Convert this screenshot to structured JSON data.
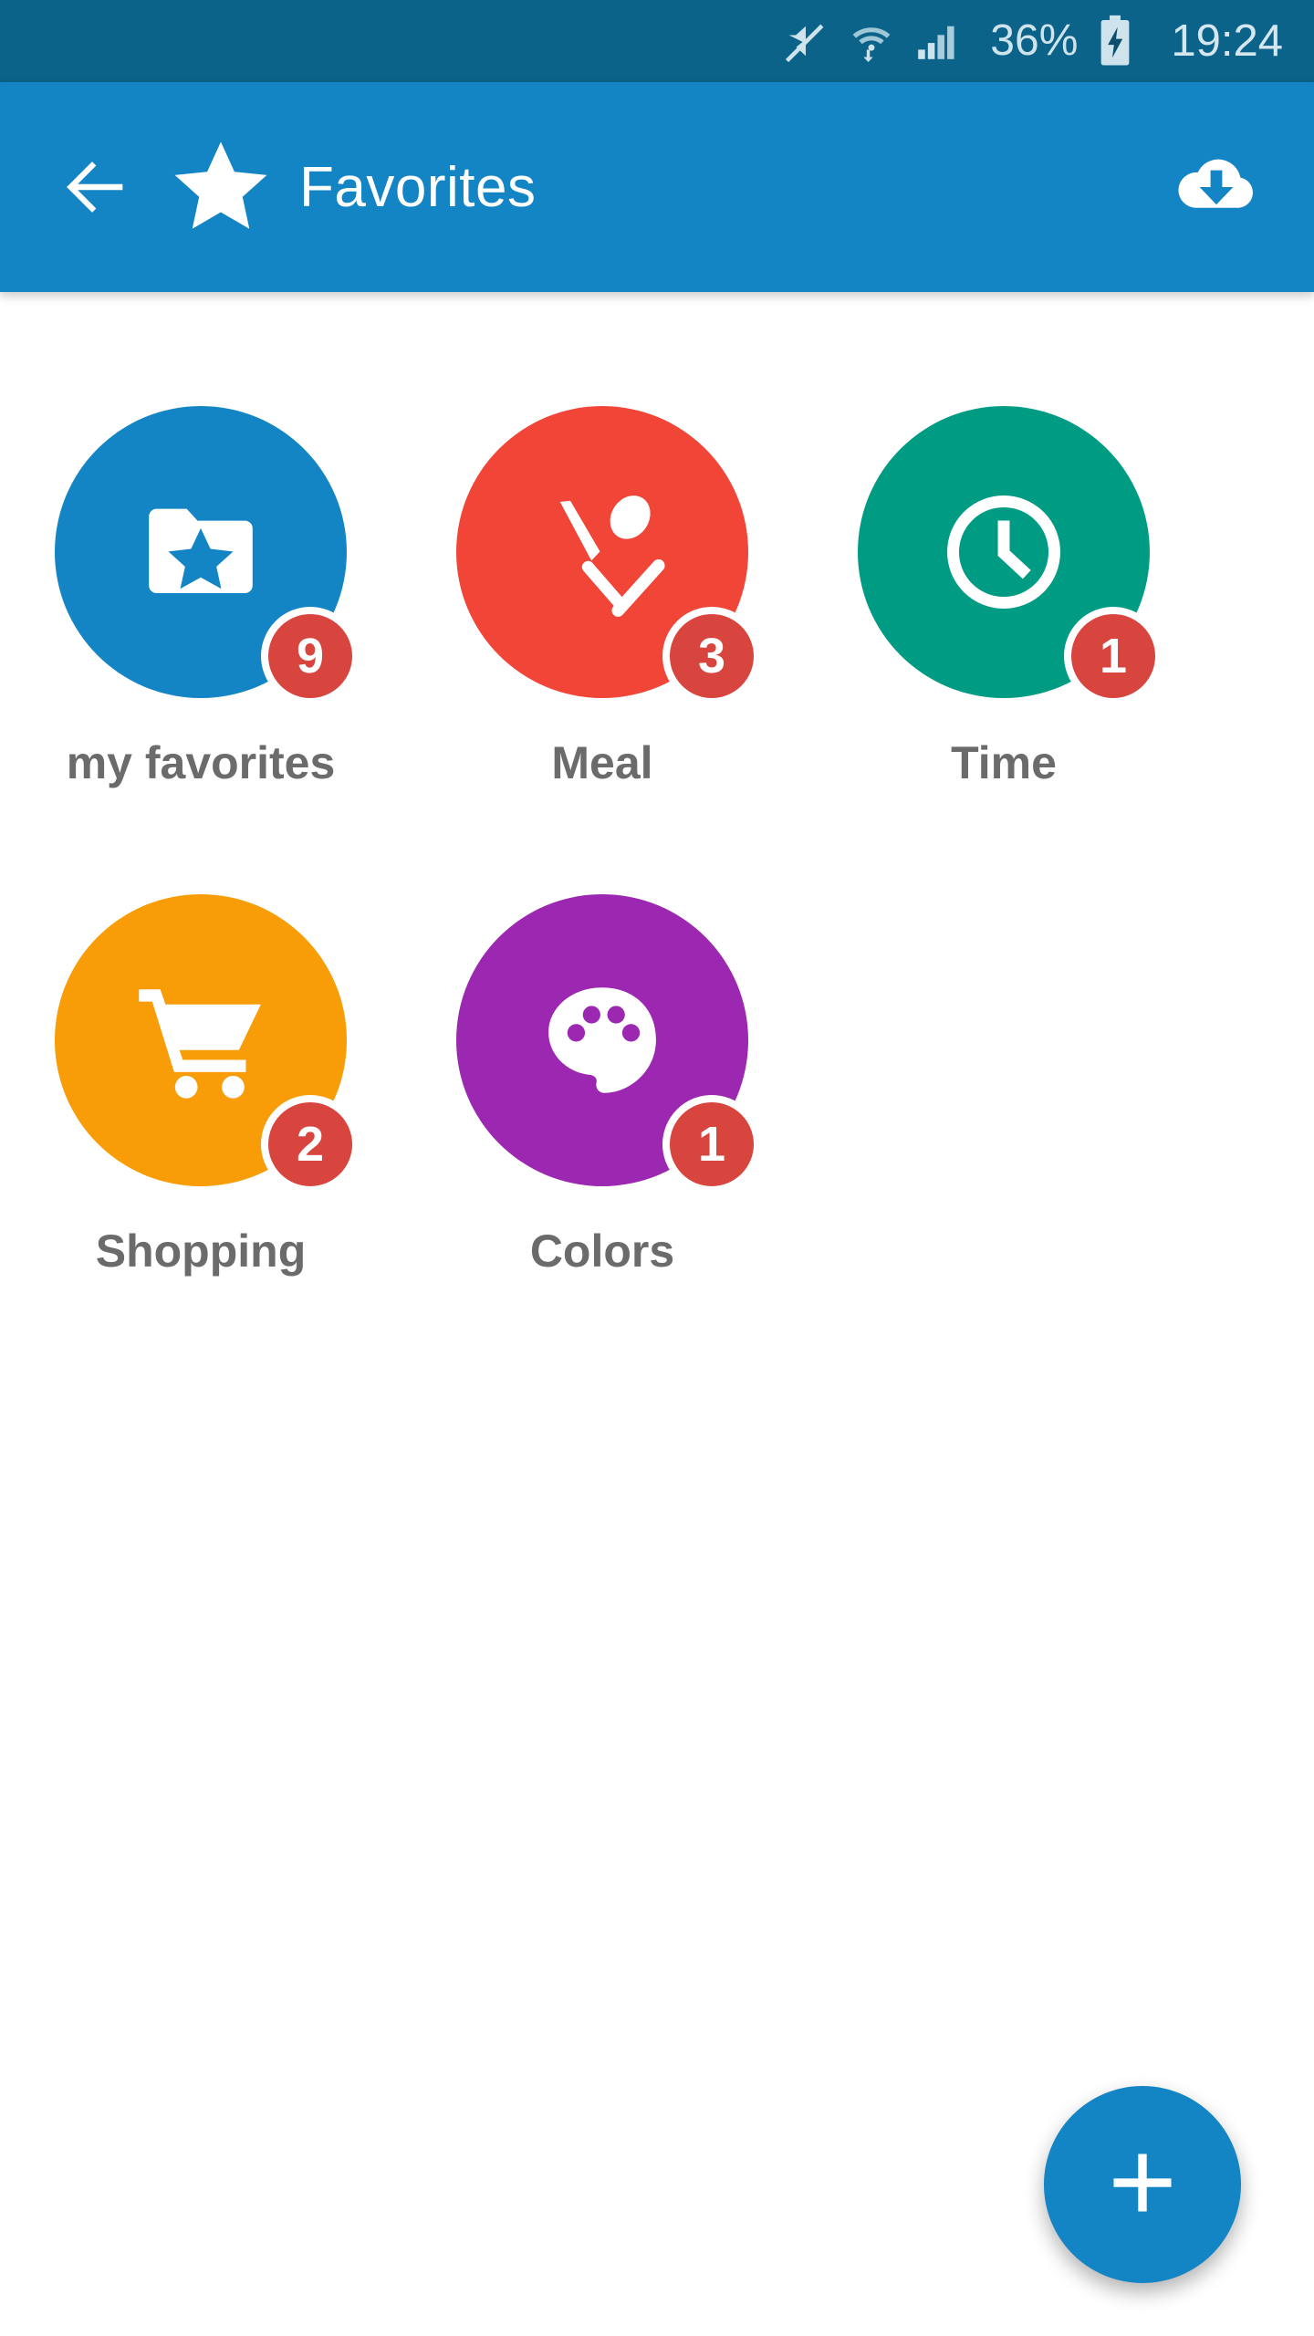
{
  "status_bar": {
    "mute_icon": "volume-mute-icon",
    "wifi_icon": "wifi-transfer-icon",
    "signal_icon": "cellular-signal-icon",
    "battery_percent": "36%",
    "battery_icon": "battery-charging-icon",
    "clock": "19:24",
    "background_color": "#0b6389",
    "text_color": "#cfe3ec"
  },
  "app_bar": {
    "back_icon": "arrow-left-icon",
    "brand_icon": "star-icon",
    "title": "Favorites",
    "action_icon": "cloud-download-icon",
    "background_color": "#1384c4",
    "title_color": "#ffffff"
  },
  "grid": {
    "items": [
      {
        "label": "my favorites",
        "icon": "folder-star-icon",
        "color": "#1384c4",
        "badge": "9"
      },
      {
        "label": "Meal",
        "icon": "knife-spoon-icon",
        "color": "#f04537",
        "badge": "3"
      },
      {
        "label": "Time",
        "icon": "clock-icon",
        "color": "#009b83",
        "badge": "1"
      },
      {
        "label": "Shopping",
        "icon": "shopping-cart-icon",
        "color": "#f89c07",
        "badge": "2"
      },
      {
        "label": "Colors",
        "icon": "paint-palette-icon",
        "color": "#9c27b0",
        "badge": "1"
      }
    ],
    "badge_color": "#d8453f",
    "label_color": "#6b6b6b"
  },
  "fab": {
    "icon": "plus-icon",
    "color": "#1384c4"
  }
}
